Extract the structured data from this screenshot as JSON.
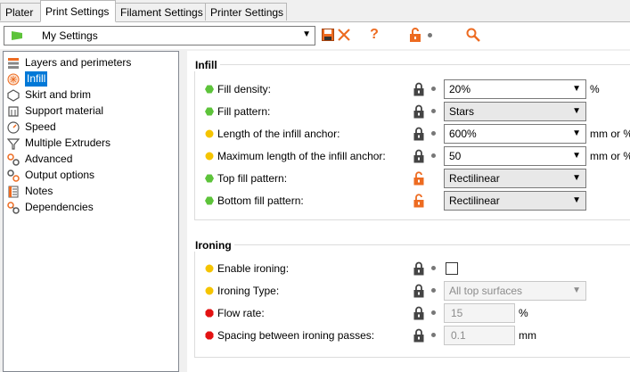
{
  "tabs": [
    "Plater",
    "Print Settings",
    "Filament Settings",
    "Printer Settings"
  ],
  "preset": {
    "name": "My Settings"
  },
  "sidebar": [
    "Layers and perimeters",
    "Infill",
    "Skirt and brim",
    "Support material",
    "Speed",
    "Multiple Extruders",
    "Advanced",
    "Output options",
    "Notes",
    "Dependencies"
  ],
  "infill": {
    "title": "Infill",
    "rows": [
      {
        "label": "Fill density:",
        "value": "20%",
        "unit": "%"
      },
      {
        "label": "Fill pattern:",
        "value": "Stars",
        "unit": ""
      },
      {
        "label": "Length of the infill anchor:",
        "value": "600%",
        "unit": "mm or %"
      },
      {
        "label": "Maximum length of the infill anchor:",
        "value": "50",
        "unit": "mm or %"
      },
      {
        "label": "Top fill pattern:",
        "value": "Rectilinear",
        "unit": ""
      },
      {
        "label": "Bottom fill pattern:",
        "value": "Rectilinear",
        "unit": ""
      }
    ]
  },
  "ironing": {
    "title": "Ironing",
    "rows": [
      {
        "label": "Enable ironing:",
        "value": "",
        "unit": ""
      },
      {
        "label": "Ironing Type:",
        "value": "All top surfaces",
        "unit": ""
      },
      {
        "label": "Flow rate:",
        "value": "15",
        "unit": "%"
      },
      {
        "label": "Spacing between ironing passes:",
        "value": "0.1",
        "unit": "mm"
      }
    ]
  },
  "colors": {
    "simple": "#5dc33a",
    "advanced": "#f5c400",
    "expert": "#e31212",
    "accent": "#ed6b21",
    "selection": "#0078d7"
  }
}
